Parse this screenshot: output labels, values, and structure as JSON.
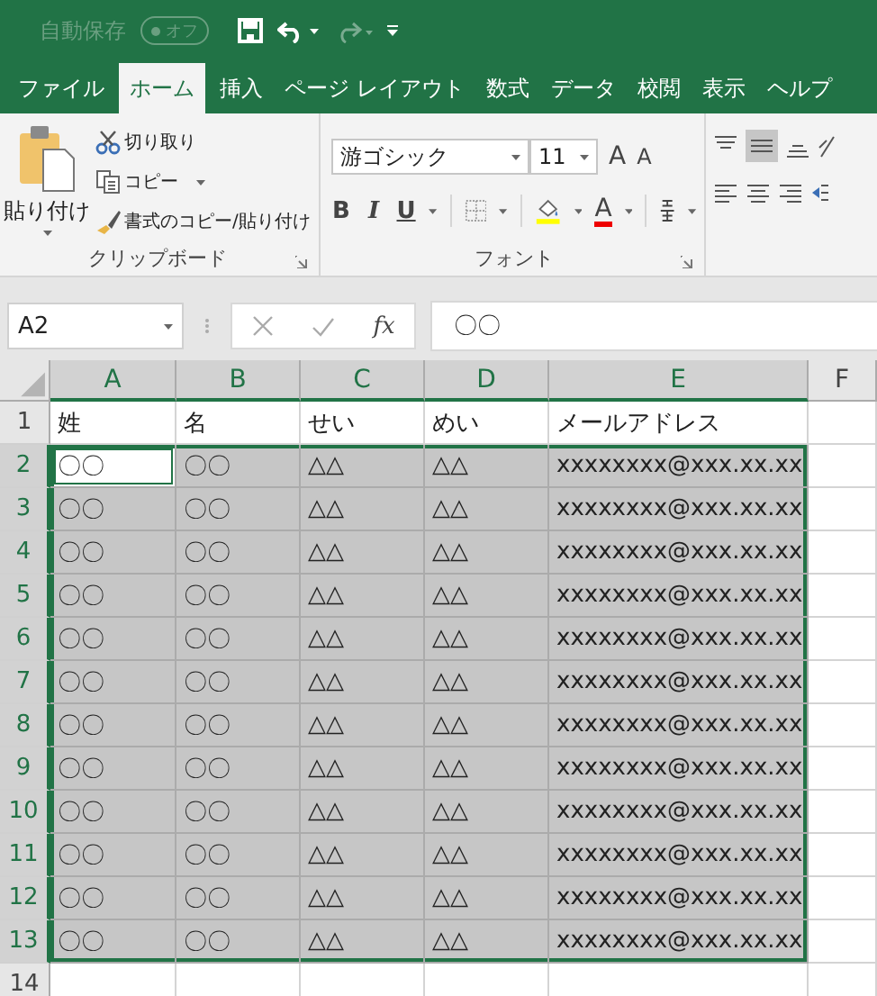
{
  "title_bar": {
    "autosave_label": "自動保存",
    "autosave_toggle": {
      "label": "オフ",
      "on": false
    },
    "redo_disabled": true
  },
  "tabs": [
    {
      "label": "ファイル",
      "selected": false
    },
    {
      "label": "ホーム",
      "selected": true
    },
    {
      "label": "挿入",
      "selected": false
    },
    {
      "label": "ページ レイアウト",
      "selected": false
    },
    {
      "label": "数式",
      "selected": false
    },
    {
      "label": "データ",
      "selected": false
    },
    {
      "label": "校閲",
      "selected": false
    },
    {
      "label": "表示",
      "selected": false
    },
    {
      "label": "ヘルプ",
      "selected": false
    }
  ],
  "ribbon": {
    "clipboard": {
      "paste": "貼り付け",
      "cut": "切り取り",
      "copy": "コピー",
      "format_painter": "書式のコピー/貼り付け",
      "label": "クリップボード"
    },
    "font": {
      "font_name": "游ゴシック",
      "font_size": "11",
      "grow_letter": "A",
      "shrink_letter": "A",
      "bold": "B",
      "italic": "I",
      "underline": "U",
      "font_color_letter": "A",
      "label": "フォント"
    },
    "alignment": {
      "middle_align_selected": true
    }
  },
  "formula_bar": {
    "name_box": "A2",
    "function_label": "fx",
    "value": "〇〇"
  },
  "sheet": {
    "columns": [
      {
        "label": "A",
        "selected": true
      },
      {
        "label": "B",
        "selected": true
      },
      {
        "label": "C",
        "selected": true
      },
      {
        "label": "D",
        "selected": true
      },
      {
        "label": "E",
        "selected": true
      },
      {
        "label": "F",
        "selected": false
      }
    ],
    "rows": [
      {
        "number": "1",
        "selected": false,
        "cells": [
          {
            "text": "姓",
            "active": false
          },
          {
            "text": "名",
            "active": false
          },
          {
            "text": "せい",
            "active": false
          },
          {
            "text": "めい",
            "active": false
          },
          {
            "text": "メールアドレス",
            "active": false
          }
        ]
      },
      {
        "number": "2",
        "selected": true,
        "cells": [
          {
            "text": "〇〇",
            "active": true
          },
          {
            "text": "〇〇",
            "active": false
          },
          {
            "text": "△△",
            "active": false
          },
          {
            "text": "△△",
            "active": false
          },
          {
            "text": "xxxxxxxx@xxx.xx.xx",
            "active": false
          }
        ]
      },
      {
        "number": "3",
        "selected": true,
        "cells": [
          {
            "text": "〇〇",
            "active": false
          },
          {
            "text": "〇〇",
            "active": false
          },
          {
            "text": "△△",
            "active": false
          },
          {
            "text": "△△",
            "active": false
          },
          {
            "text": "xxxxxxxx@xxx.xx.xx",
            "active": false
          }
        ]
      },
      {
        "number": "4",
        "selected": true,
        "cells": [
          {
            "text": "〇〇",
            "active": false
          },
          {
            "text": "〇〇",
            "active": false
          },
          {
            "text": "△△",
            "active": false
          },
          {
            "text": "△△",
            "active": false
          },
          {
            "text": "xxxxxxxx@xxx.xx.xx",
            "active": false
          }
        ]
      },
      {
        "number": "5",
        "selected": true,
        "cells": [
          {
            "text": "〇〇",
            "active": false
          },
          {
            "text": "〇〇",
            "active": false
          },
          {
            "text": "△△",
            "active": false
          },
          {
            "text": "△△",
            "active": false
          },
          {
            "text": "xxxxxxxx@xxx.xx.xx",
            "active": false
          }
        ]
      },
      {
        "number": "6",
        "selected": true,
        "cells": [
          {
            "text": "〇〇",
            "active": false
          },
          {
            "text": "〇〇",
            "active": false
          },
          {
            "text": "△△",
            "active": false
          },
          {
            "text": "△△",
            "active": false
          },
          {
            "text": "xxxxxxxx@xxx.xx.xx",
            "active": false
          }
        ]
      },
      {
        "number": "7",
        "selected": true,
        "cells": [
          {
            "text": "〇〇",
            "active": false
          },
          {
            "text": "〇〇",
            "active": false
          },
          {
            "text": "△△",
            "active": false
          },
          {
            "text": "△△",
            "active": false
          },
          {
            "text": "xxxxxxxx@xxx.xx.xx",
            "active": false
          }
        ]
      },
      {
        "number": "8",
        "selected": true,
        "cells": [
          {
            "text": "〇〇",
            "active": false
          },
          {
            "text": "〇〇",
            "active": false
          },
          {
            "text": "△△",
            "active": false
          },
          {
            "text": "△△",
            "active": false
          },
          {
            "text": "xxxxxxxx@xxx.xx.xx",
            "active": false
          }
        ]
      },
      {
        "number": "9",
        "selected": true,
        "cells": [
          {
            "text": "〇〇",
            "active": false
          },
          {
            "text": "〇〇",
            "active": false
          },
          {
            "text": "△△",
            "active": false
          },
          {
            "text": "△△",
            "active": false
          },
          {
            "text": "xxxxxxxx@xxx.xx.xx",
            "active": false
          }
        ]
      },
      {
        "number": "10",
        "selected": true,
        "cells": [
          {
            "text": "〇〇",
            "active": false
          },
          {
            "text": "〇〇",
            "active": false
          },
          {
            "text": "△△",
            "active": false
          },
          {
            "text": "△△",
            "active": false
          },
          {
            "text": "xxxxxxxx@xxx.xx.xx",
            "active": false
          }
        ]
      },
      {
        "number": "11",
        "selected": true,
        "cells": [
          {
            "text": "〇〇",
            "active": false
          },
          {
            "text": "〇〇",
            "active": false
          },
          {
            "text": "△△",
            "active": false
          },
          {
            "text": "△△",
            "active": false
          },
          {
            "text": "xxxxxxxx@xxx.xx.xx",
            "active": false
          }
        ]
      },
      {
        "number": "12",
        "selected": true,
        "cells": [
          {
            "text": "〇〇",
            "active": false
          },
          {
            "text": "〇〇",
            "active": false
          },
          {
            "text": "△△",
            "active": false
          },
          {
            "text": "△△",
            "active": false
          },
          {
            "text": "xxxxxxxx@xxx.xx.xx",
            "active": false
          }
        ]
      },
      {
        "number": "13",
        "selected": true,
        "cells": [
          {
            "text": "〇〇",
            "active": false
          },
          {
            "text": "〇〇",
            "active": false
          },
          {
            "text": "△△",
            "active": false
          },
          {
            "text": "△△",
            "active": false
          },
          {
            "text": "xxxxxxxx@xxx.xx.xx",
            "active": false
          }
        ]
      },
      {
        "number": "14",
        "selected": false
      }
    ]
  }
}
